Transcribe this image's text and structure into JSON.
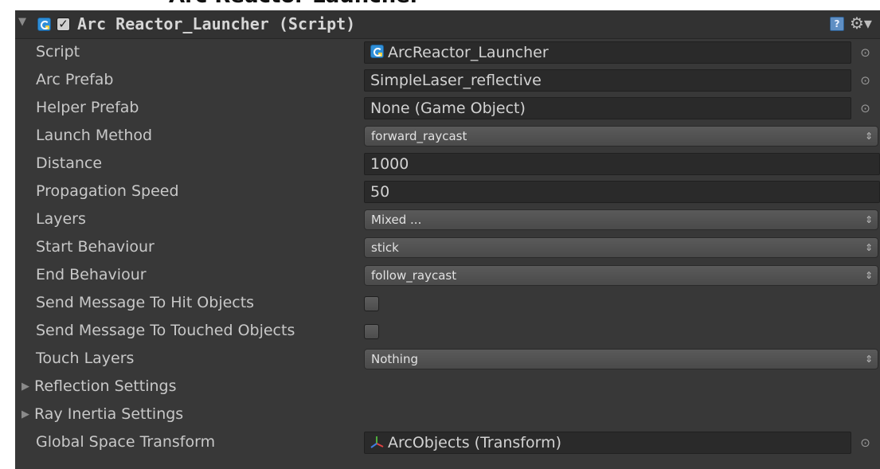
{
  "page_heading_partial": "Arc Reactor Launcher",
  "component": {
    "title": "Arc Reactor_Launcher (Script)",
    "enabled": true,
    "help_icon": "help-icon",
    "settings_icon": "gear-icon",
    "fields": {
      "script": {
        "label": "Script",
        "value": "ArcReactor_Launcher"
      },
      "arc_prefab": {
        "label": "Arc Prefab",
        "value": "SimpleLaser_reflective"
      },
      "helper_prefab": {
        "label": "Helper Prefab",
        "value": "None (Game Object)"
      },
      "launch_method": {
        "label": "Launch Method",
        "value": "forward_raycast"
      },
      "distance": {
        "label": "Distance",
        "value": "1000"
      },
      "propagation_speed": {
        "label": "Propagation Speed",
        "value": "50"
      },
      "layers": {
        "label": "Layers",
        "value": "Mixed ..."
      },
      "start_behaviour": {
        "label": "Start Behaviour",
        "value": "stick"
      },
      "end_behaviour": {
        "label": "End Behaviour",
        "value": "follow_raycast"
      },
      "send_message_hit": {
        "label": "Send Message To Hit Objects",
        "checked": false
      },
      "send_message_touched": {
        "label": "Send Message To Touched Objects",
        "checked": false
      },
      "touch_layers": {
        "label": "Touch Layers",
        "value": "Nothing"
      },
      "reflection_settings": {
        "label": "Reflection Settings"
      },
      "ray_inertia_settings": {
        "label": "Ray Inertia Settings"
      },
      "global_space_transform": {
        "label": "Global Space Transform",
        "value": "ArcObjects (Transform)"
      }
    }
  },
  "colors": {
    "panel_bg": "#383838",
    "header_bg": "#323232",
    "field_bg": "#2a2a2a",
    "label_text": "#c8c8c8",
    "script_icon_accent": "#2f8fd8"
  }
}
